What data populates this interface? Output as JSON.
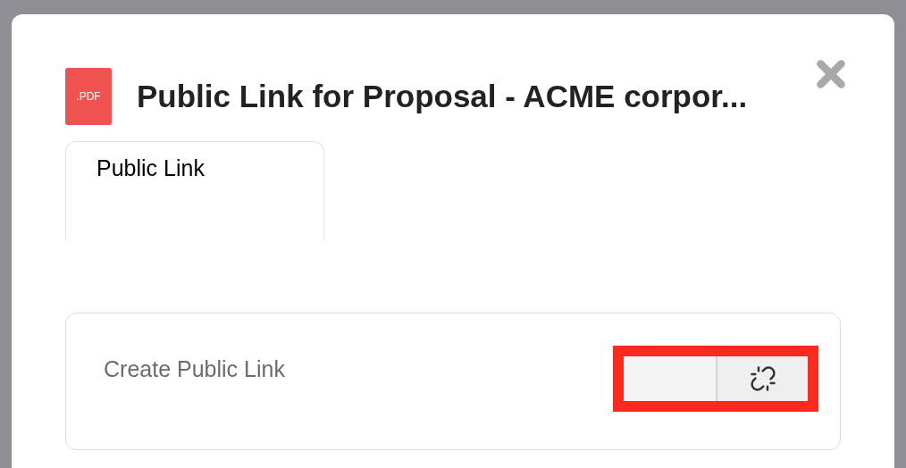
{
  "dialog": {
    "file_badge": ".PDF",
    "title": "Public Link for Proposal - ACME corpor..."
  },
  "tabs": [
    {
      "label": "Public Link",
      "selected": true
    }
  ],
  "public_link": {
    "label": "Create Public Link",
    "on": false,
    "highlighted": true
  }
}
